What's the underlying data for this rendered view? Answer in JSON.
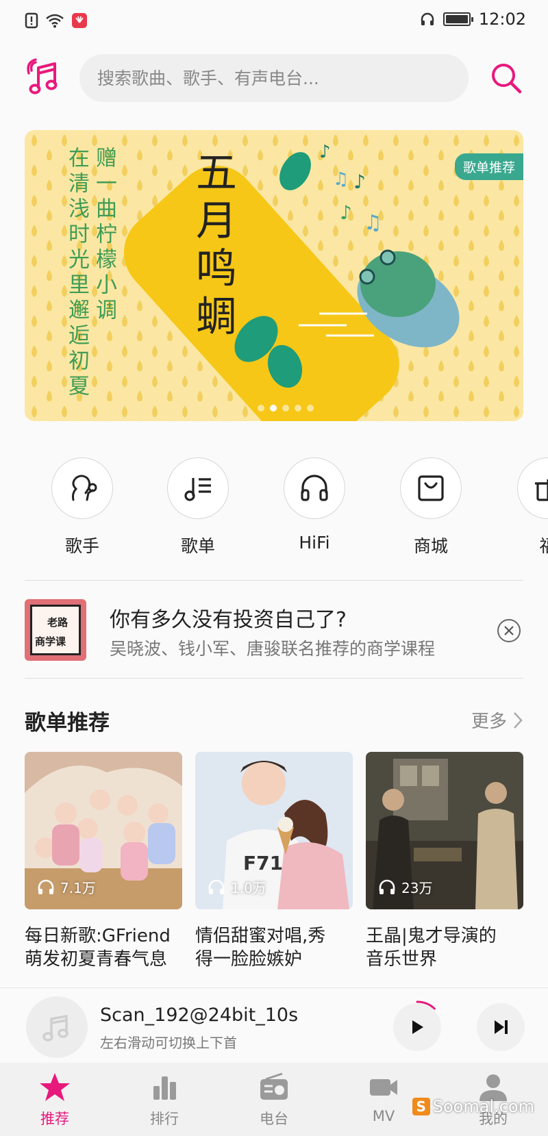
{
  "status_bar": {
    "time": "12:02"
  },
  "header": {
    "search_placeholder": "搜索歌曲、歌手、有声电台..."
  },
  "banner": {
    "tag": "歌单推荐",
    "headline": "五月鸣蜩",
    "poem_col1": "赠一曲柠檬小调",
    "poem_col2": "在清浅时光里邂逅初夏",
    "page_count": 5,
    "active_page": 1
  },
  "categories": [
    {
      "label": "歌手",
      "icon": "singer-icon"
    },
    {
      "label": "歌单",
      "icon": "playlist-icon"
    },
    {
      "label": "HiFi",
      "icon": "headphones-icon"
    },
    {
      "label": "商城",
      "icon": "store-bag-icon"
    },
    {
      "label": "福",
      "icon": "gift-icon"
    }
  ],
  "ad": {
    "thumb_line1": "老路",
    "thumb_line2": "商学课",
    "title": "你有多久没有投资自己了?",
    "subtitle": "吴晓波、钱小军、唐骏联名推荐的商学课程"
  },
  "section": {
    "title": "歌单推荐",
    "more": "更多"
  },
  "playlists": [
    {
      "count": "7.1万",
      "title_line1": "每日新歌:GFriend",
      "title_line2": "萌发初夏青春气息"
    },
    {
      "count": "1.0万",
      "title_line1": "情侣甜蜜对唱,秀",
      "title_line2": "得一脸脸嫉妒"
    },
    {
      "count": "23万",
      "title_line1": "王晶|鬼才导演的",
      "title_line2": "音乐世界"
    }
  ],
  "player": {
    "track": "Scan_192@24bit_10s",
    "hint": "左右滑动可切换上下首",
    "progress": 0.12
  },
  "tabs": [
    {
      "label": "推荐",
      "icon": "star-icon",
      "active": true
    },
    {
      "label": "排行",
      "icon": "chart-icon",
      "active": false
    },
    {
      "label": "电台",
      "icon": "radio-icon",
      "active": false
    },
    {
      "label": "MV",
      "icon": "video-camera-icon",
      "active": false
    },
    {
      "label": "我的",
      "icon": "profile-icon",
      "active": false
    }
  ],
  "watermark": "Soomal.com",
  "colors": {
    "accent": "#e8197d",
    "banner_bg": "#fbe7a3",
    "banner_tag": "#39a88f"
  }
}
